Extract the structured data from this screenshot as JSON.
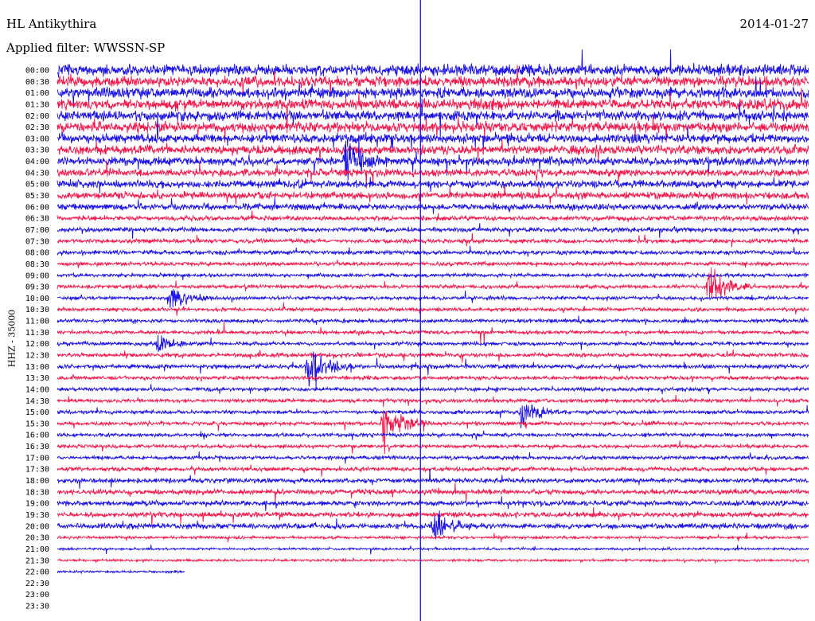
{
  "header": {
    "station": "HL Antikythira",
    "date": "2014-01-27",
    "filter": "Applied filter: WWSSN-SP"
  },
  "colors": {
    "trace_a": "#1a10e8",
    "trace_b": "#f5164a",
    "marker": "#1a10e8"
  },
  "chart_data": {
    "type": "line",
    "title": "HL Antikythira",
    "ylabel": "HHZ - 35000",
    "tick_labels": [
      "00:00",
      "00:30",
      "01:00",
      "01:30",
      "02:00",
      "02:30",
      "03:00",
      "03:30",
      "04:00",
      "04:30",
      "05:00",
      "05:30",
      "06:00",
      "06:30",
      "07:00",
      "07:30",
      "08:00",
      "08:30",
      "09:00",
      "09:30",
      "10:00",
      "10:30",
      "11:00",
      "11:30",
      "12:00",
      "12:30",
      "13:00",
      "13:30",
      "14:00",
      "14:30",
      "15:00",
      "15:30",
      "16:00",
      "16:30",
      "17:00",
      "17:30",
      "18:00",
      "18:30",
      "19:00",
      "19:30",
      "20:00",
      "20:30",
      "21:00",
      "21:30",
      "22:00",
      "22:30",
      "23:00",
      "23:30"
    ],
    "row_minutes": 30,
    "series_colors_alternate": [
      "#1a10e8",
      "#f5164a"
    ],
    "row_noise_level": [
      2.4,
      2.3,
      2.3,
      2.3,
      2.2,
      2.2,
      2.0,
      1.9,
      1.8,
      1.6,
      1.6,
      1.5,
      1.4,
      1.0,
      1.0,
      0.9,
      0.9,
      0.8,
      0.8,
      0.8,
      0.8,
      0.8,
      0.8,
      0.8,
      0.8,
      0.9,
      0.9,
      0.8,
      0.8,
      0.8,
      0.8,
      0.8,
      0.8,
      0.8,
      0.8,
      0.9,
      1.0,
      1.1,
      1.1,
      1.1,
      1.2,
      0.6,
      0.5,
      0.5,
      0.5
    ],
    "last_row_fraction": 0.17,
    "events": [
      {
        "time": "04:00",
        "offset_min": 11.5,
        "amplitude": "large"
      },
      {
        "time": "09:30",
        "offset_min": 26.0,
        "amplitude": "large"
      },
      {
        "time": "10:00",
        "offset_min": 4.5,
        "amplitude": "medium"
      },
      {
        "time": "12:00",
        "offset_min": 4.0,
        "amplitude": "small"
      },
      {
        "time": "13:00",
        "offset_min": 10.0,
        "amplitude": "large"
      },
      {
        "time": "13:00",
        "offset_min": 39.5,
        "amplitude": "medium"
      },
      {
        "time": "14:00",
        "offset_min": 30.5,
        "amplitude": "small"
      },
      {
        "time": "15:00",
        "offset_min": 18.5,
        "amplitude": "medium"
      },
      {
        "time": "15:30",
        "offset_min": 13.0,
        "amplitude": "large"
      },
      {
        "time": "20:00",
        "offset_min": 15.0,
        "amplitude": "medium"
      }
    ],
    "marker_offset_min": 14.5
  }
}
